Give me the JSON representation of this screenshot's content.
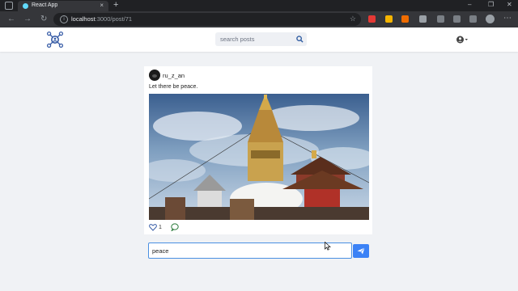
{
  "browser": {
    "tab_title": "React App",
    "url_host": "localhost",
    "url_path": ":3000/post/71",
    "new_tab_symbol": "+",
    "close_symbol": "×",
    "back_symbol": "←",
    "forward_symbol": "→",
    "reload_symbol": "↻",
    "minimize_symbol": "–",
    "restore_symbol": "❐",
    "window_close_symbol": "✕",
    "menu_symbol": "⋯",
    "info_symbol": "i",
    "star_symbol": "☆"
  },
  "header": {
    "search_placeholder": "search posts"
  },
  "post": {
    "username": "ru_z_an",
    "caption": "Let there be peace.",
    "like_count": "1"
  },
  "comment": {
    "value": "peace"
  },
  "colors": {
    "accent": "#3b82f6",
    "logo": "#3b5fa8",
    "background": "#f0f2f5"
  },
  "icons": [
    "tab-menu-icon",
    "info-icon",
    "star-icon",
    "app-logo-icon",
    "search-icon",
    "user-icon",
    "heart-icon",
    "comment-icon",
    "send-icon"
  ]
}
